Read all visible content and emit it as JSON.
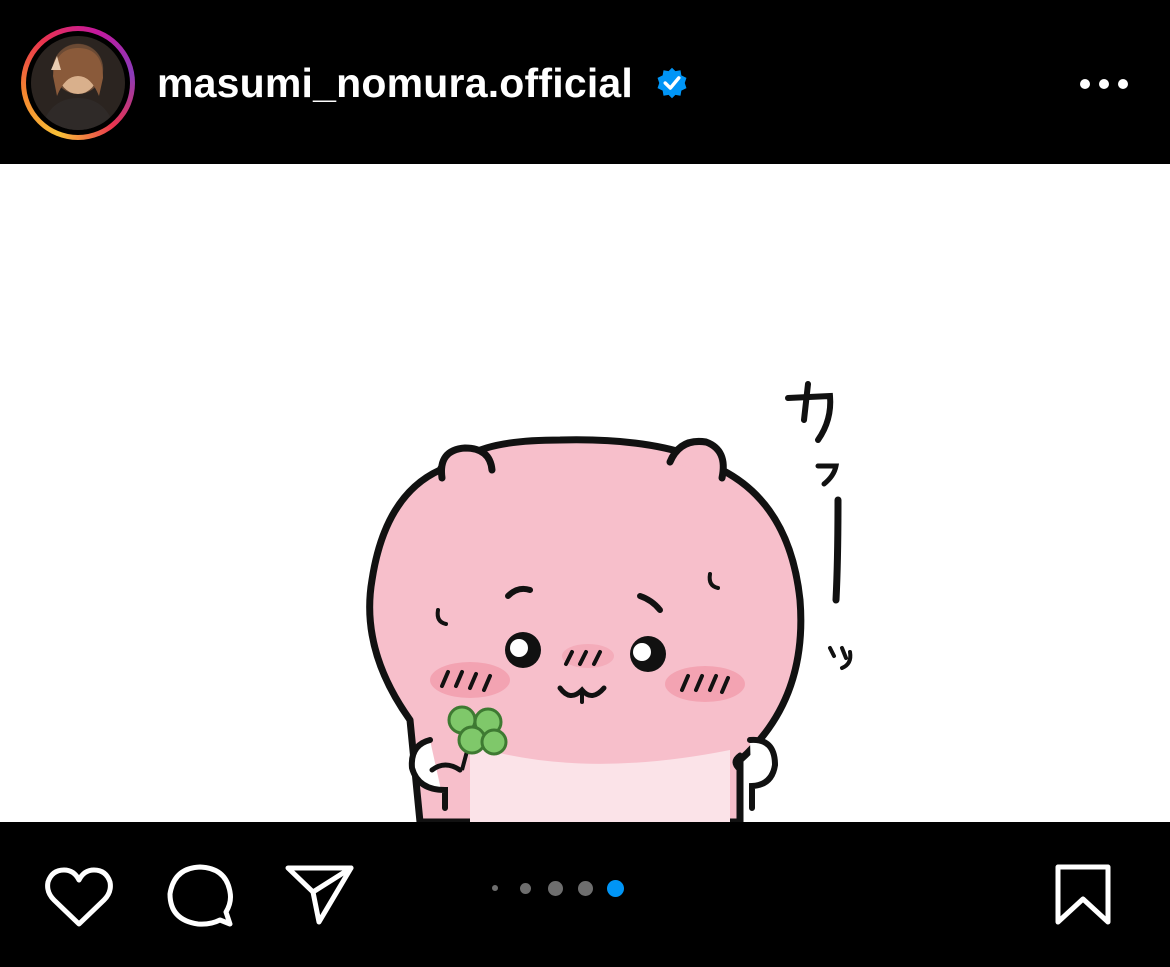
{
  "post": {
    "username": "masumi_nomura.official",
    "verified": true,
    "image_text": "カァーッ"
  },
  "icons": {
    "avatar": "profile-photo",
    "verified": "verified-badge-icon",
    "more": "more-options-icon",
    "like": "heart-icon",
    "comment": "comment-bubble-icon",
    "share": "paper-plane-icon",
    "save": "bookmark-icon"
  },
  "carousel": {
    "total": 5,
    "active_index": 4
  },
  "colors": {
    "background": "#000000",
    "accent_blue": "#0095f6",
    "character_pink": "#f7bfcb",
    "blush": "#f19aa9",
    "clover": "#7fc86a"
  }
}
